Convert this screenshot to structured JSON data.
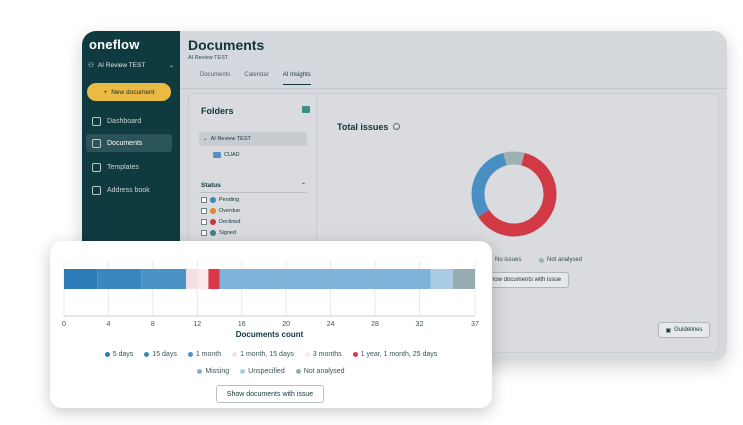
{
  "app": {
    "logo": "oneflow",
    "workspace": "AI Review TEST",
    "new_document": "New document",
    "nav": [
      "Dashboard",
      "Documents",
      "Templates",
      "Address book"
    ],
    "page_title": "Documents",
    "breadcrumb": "AI Review TEST",
    "tabs": [
      "Documents",
      "Calendar",
      "AI Insights"
    ],
    "folders_title": "Folders",
    "folder_root": "AI Review TEST",
    "folder_child": "CUAD",
    "status_title": "Status",
    "statuses": [
      {
        "label": "Pending",
        "color": "#3d86b8"
      },
      {
        "label": "Overdue",
        "color": "#e08a2e"
      },
      {
        "label": "Declined",
        "color": "#c9373f"
      },
      {
        "label": "Signed",
        "color": "#3e7f86"
      }
    ],
    "total_issues": "Total issues",
    "donut_legend": [
      "No issues",
      "Not analysed"
    ],
    "show_issue_bg": "how documents with issue",
    "guidelines": "Guidelines"
  },
  "card": {
    "x_label": "Documents count",
    "show_issue": "Show documents with issue"
  },
  "chart_data": {
    "type": "bar",
    "orientation": "horizontal-stacked",
    "xlabel": "Documents count",
    "xlim": [
      0,
      37
    ],
    "x_ticks": [
      "0",
      "4",
      "8",
      "12",
      "16",
      "20",
      "24",
      "28",
      "32",
      "37"
    ],
    "series": [
      {
        "name": "5 days",
        "value": 3,
        "color": "#2c7bb6"
      },
      {
        "name": "15 days",
        "value": 4,
        "color": "#3a87c0"
      },
      {
        "name": "1 month",
        "value": 4,
        "color": "#4a93c6"
      },
      {
        "name": "1 month, 15 days",
        "value": 1,
        "color": "#f6dfe3"
      },
      {
        "name": "3 months",
        "value": 1,
        "color": "#f9e9ec"
      },
      {
        "name": "1 year, 1 month, 25 days",
        "value": 1,
        "color": "#d8384a"
      },
      {
        "name": "Missing",
        "value": 19,
        "color": "#7fb3d9"
      },
      {
        "name": "Unspecified",
        "value": 2,
        "color": "#a9cde6"
      },
      {
        "name": "Not analysed",
        "value": 2,
        "color": "#98adb2"
      }
    ],
    "donut": [
      {
        "name": "Issues",
        "value": 62,
        "color": "#d13945"
      },
      {
        "name": "No issues",
        "value": 30,
        "color": "#4a8fc3"
      },
      {
        "name": "Not analysed",
        "value": 8,
        "color": "#9fb0b4"
      }
    ]
  }
}
